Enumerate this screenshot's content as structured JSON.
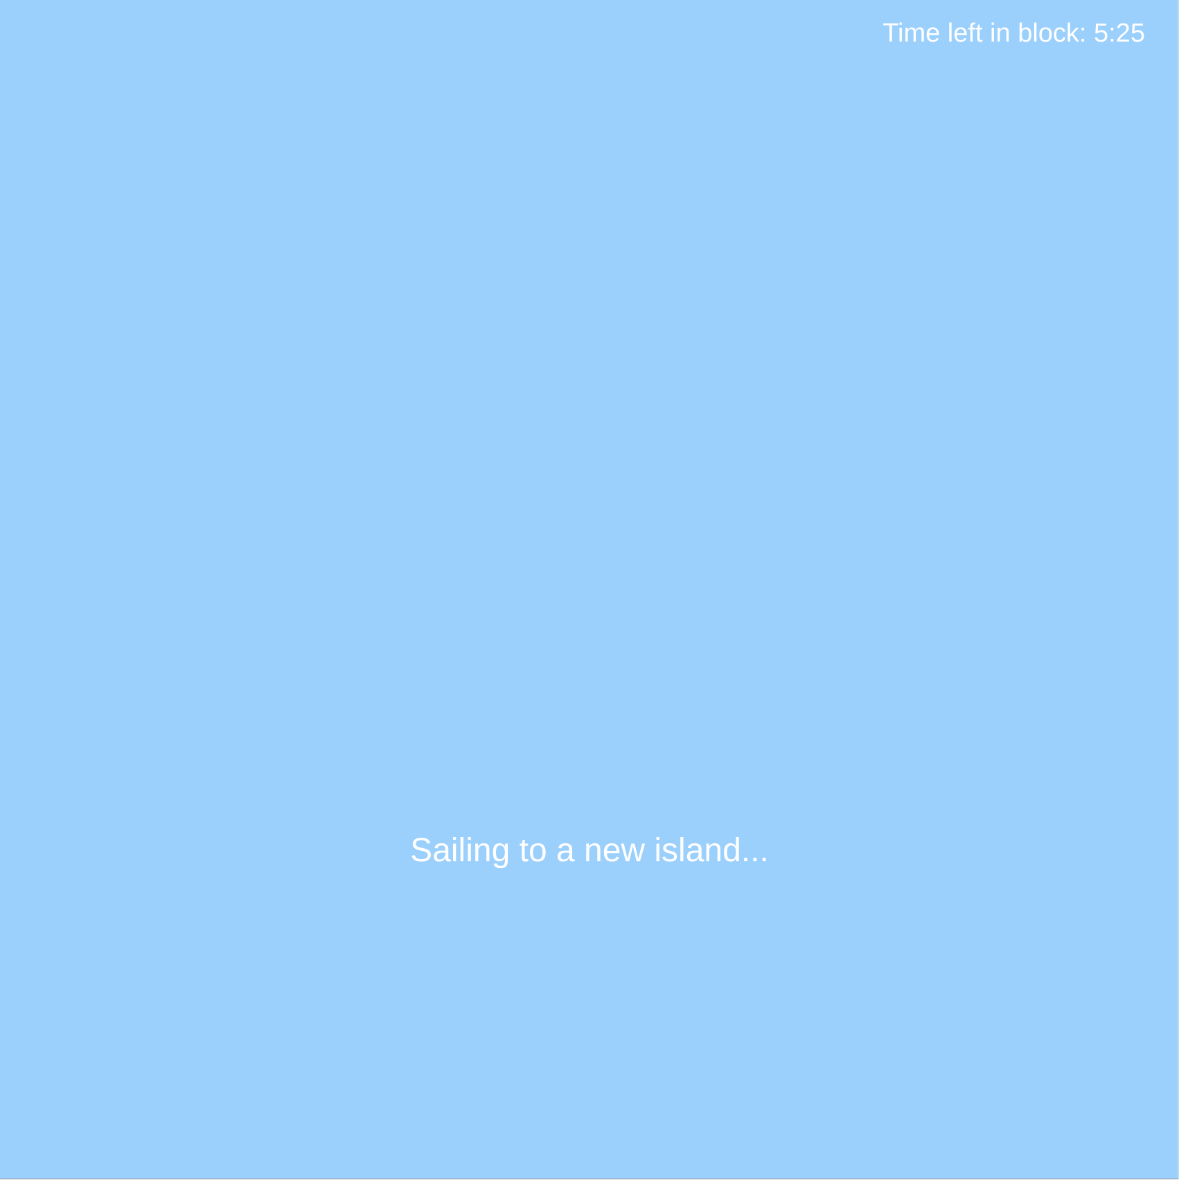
{
  "timer": {
    "label": "Time left in block:",
    "value": "5:25"
  },
  "status": {
    "message": "Sailing to a new island..."
  },
  "colors": {
    "sea": "#9BCFFC",
    "text": "#FFFFFF"
  }
}
